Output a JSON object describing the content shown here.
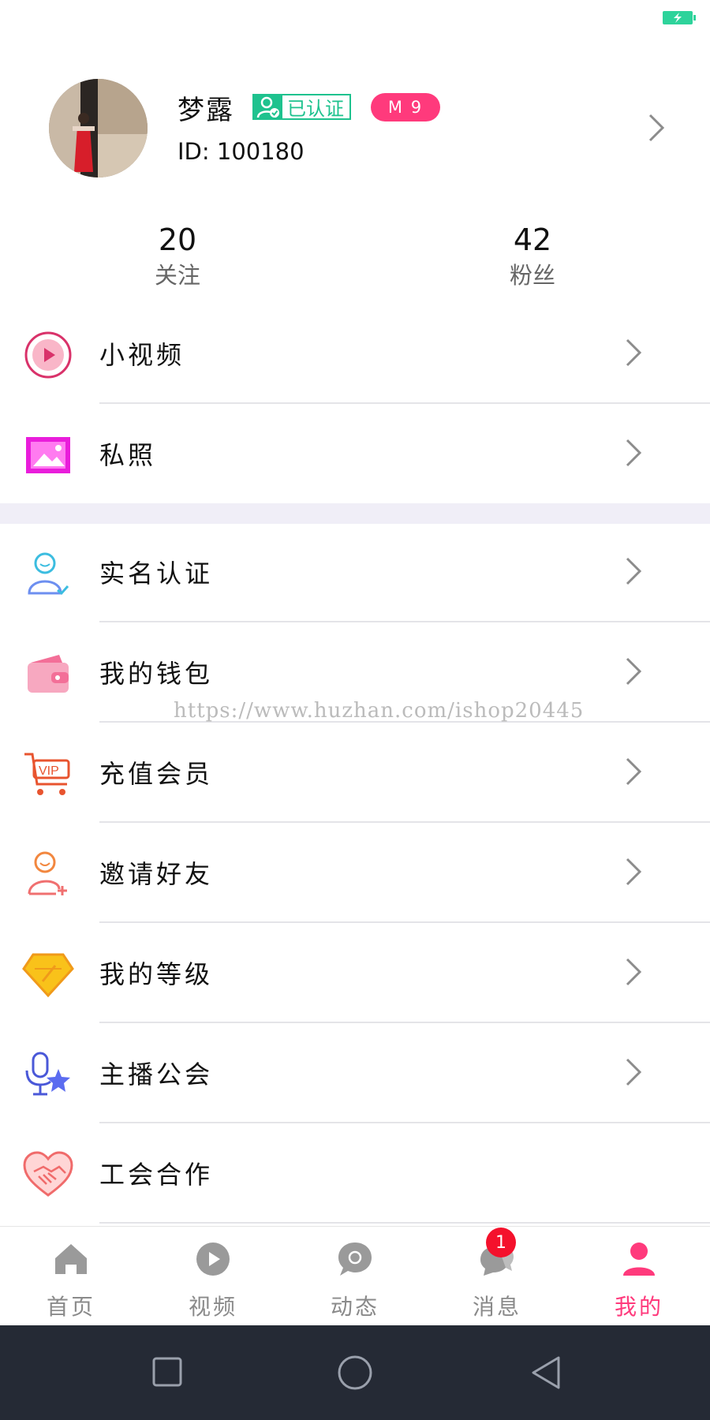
{
  "profile": {
    "name": "梦露",
    "verified_label": "已认证",
    "level_label": "M 9",
    "id_text": "ID: 100180"
  },
  "stats": {
    "following_count": "20",
    "following_label": "关注",
    "fans_count": "42",
    "fans_label": "粉丝"
  },
  "menu_group1": [
    {
      "label": "小视频",
      "icon": "play-circle-icon"
    },
    {
      "label": "私照",
      "icon": "photo-icon"
    }
  ],
  "menu_group2": [
    {
      "label": "实名认证",
      "icon": "user-verify-icon"
    },
    {
      "label": "我的钱包",
      "icon": "wallet-icon"
    },
    {
      "label": "充值会员",
      "icon": "vip-cart-icon"
    },
    {
      "label": "邀请好友",
      "icon": "add-friend-icon"
    },
    {
      "label": "我的等级",
      "icon": "diamond-level-icon"
    },
    {
      "label": "主播公会",
      "icon": "microphone-star-icon"
    },
    {
      "label": "工会合作",
      "icon": "handshake-heart-icon"
    }
  ],
  "watermark": "https://www.huzhan.com/ishop20445",
  "tabs": [
    {
      "label": "首页",
      "icon": "home-icon"
    },
    {
      "label": "视频",
      "icon": "video-icon"
    },
    {
      "label": "动态",
      "icon": "moments-icon"
    },
    {
      "label": "消息",
      "icon": "message-icon"
    },
    {
      "label": "我的",
      "icon": "profile-icon"
    }
  ],
  "messages_badge": "1",
  "colors": {
    "accent": "#ff3a7c",
    "verified": "#1ec28e",
    "battery": "#2ed39b",
    "separator": "#f0eef7",
    "navbar": "#252a35"
  }
}
